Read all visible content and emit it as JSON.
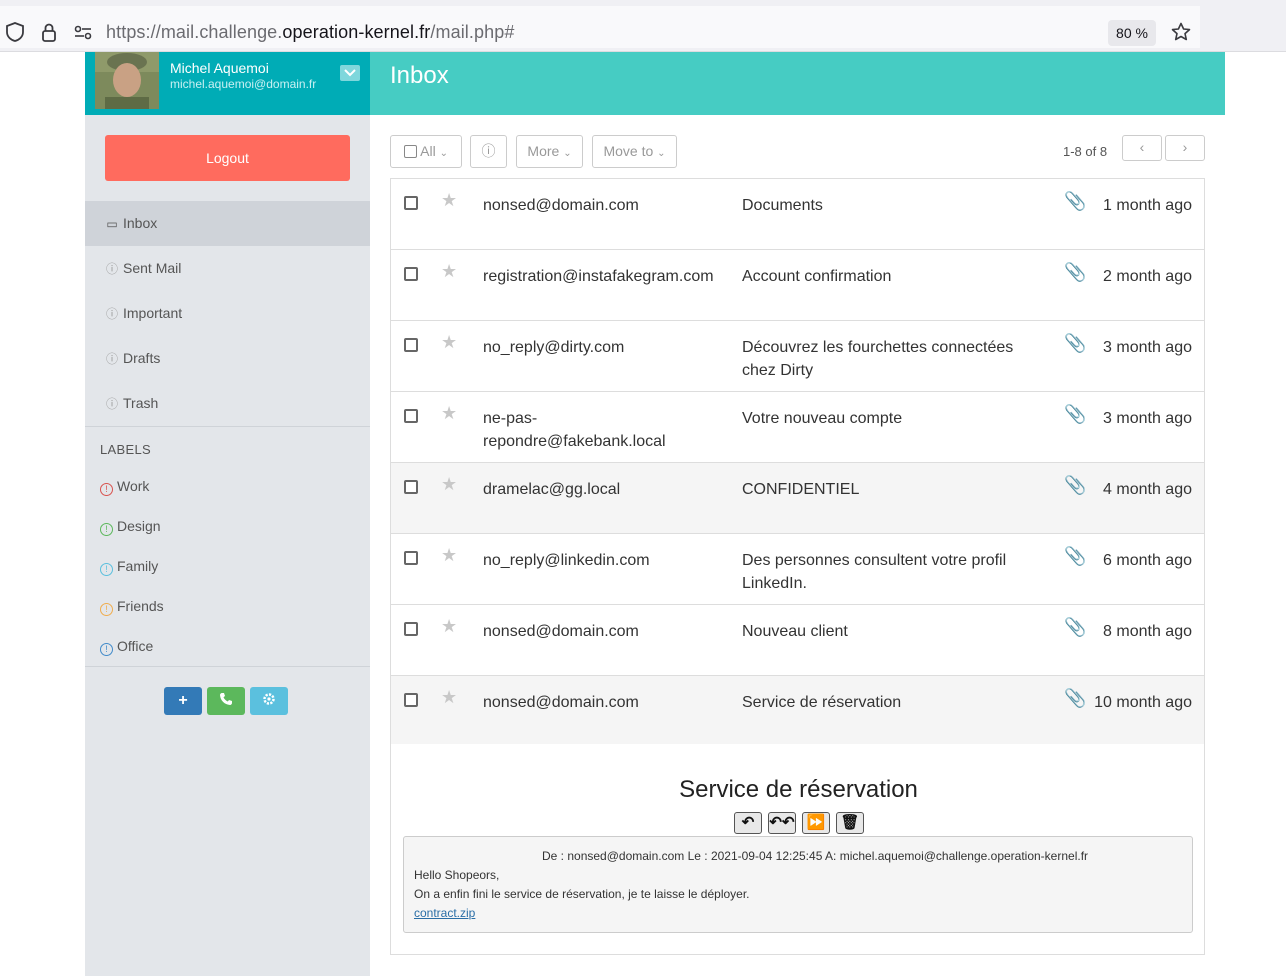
{
  "browser": {
    "url_prefix": "https://mail.challenge.",
    "url_host": "operation-kernel.fr",
    "url_suffix": "/mail.php#",
    "zoom": "80 %"
  },
  "profile": {
    "name": "Michel Aquemoi",
    "email": "michel.aquemoi@domain.fr"
  },
  "sidebar": {
    "logout_label": "Logout",
    "folders": [
      {
        "label": "Inbox",
        "active": true
      },
      {
        "label": "Sent Mail"
      },
      {
        "label": "Important"
      },
      {
        "label": "Drafts"
      },
      {
        "label": "Trash"
      }
    ],
    "labels_heading": "LABELS",
    "labels": [
      {
        "label": "Work",
        "color": "#d9534f"
      },
      {
        "label": "Design",
        "color": "#5cb85c"
      },
      {
        "label": "Family",
        "color": "#5bc0de"
      },
      {
        "label": "Friends",
        "color": "#f0ad4e"
      },
      {
        "label": "Office",
        "color": "#428bca"
      }
    ]
  },
  "header": {
    "title": "Inbox"
  },
  "toolbar": {
    "all_label": "All",
    "more_label": "More",
    "move_label": "Move to",
    "pager": "1-8 of 8"
  },
  "mails": [
    {
      "from": "nonsed@domain.com",
      "subject": "Documents",
      "date": "1 month ago"
    },
    {
      "from": "registration@instafakegram.com",
      "subject": "Account confirmation",
      "date": "2 month ago"
    },
    {
      "from": "no_reply@dirty.com",
      "subject": "Découvrez les fourchettes connectées chez Dirty",
      "date": "3 month ago"
    },
    {
      "from": "ne-pas-repondre@fakebank.local",
      "subject": "Votre nouveau compte",
      "date": "3 month ago"
    },
    {
      "from": "dramelac@gg.local",
      "subject": "CONFIDENTIEL",
      "date": "4 month ago"
    },
    {
      "from": "no_reply@linkedin.com",
      "subject": "Des personnes consultent votre profil LinkedIn.",
      "date": "6 month ago"
    },
    {
      "from": "nonsed@domain.com",
      "subject": "Nouveau client",
      "date": "8 month ago"
    },
    {
      "from": "nonsed@domain.com",
      "subject": "Service de réservation",
      "date": "10 month ago"
    }
  ],
  "preview": {
    "title": "Service de réservation",
    "header": "De : nonsed@domain.com Le : 2021-09-04 12:25:45 A: michel.aquemoi@challenge.operation-kernel.fr",
    "greeting": "Hello Shopeors,",
    "body": "On a enfin fini le service de réservation, je te laisse le déployer.",
    "attachment": "contract.zip"
  },
  "colors": {
    "profile_bg": "#00acb6",
    "header_bg": "#46ccc3",
    "logout_bg": "#ff6b5e",
    "sidebar_bg": "#e3e6ea"
  }
}
